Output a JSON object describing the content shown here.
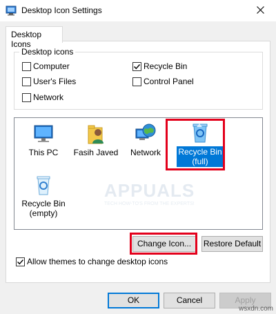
{
  "window": {
    "title": "Desktop Icon Settings"
  },
  "tabs": [
    {
      "label": "Desktop Icons"
    }
  ],
  "group": {
    "legend": "Desktop icons",
    "checkboxes": [
      {
        "label": "Computer",
        "checked": false
      },
      {
        "label": "Recycle Bin",
        "checked": true
      },
      {
        "label": "User's Files",
        "checked": false
      },
      {
        "label": "Control Panel",
        "checked": false
      },
      {
        "label": "Network",
        "checked": false
      }
    ]
  },
  "icons": [
    {
      "label": "This PC",
      "icon": "this-pc-icon",
      "selected": false
    },
    {
      "label": "Fasih Javed",
      "icon": "user-folder-icon",
      "selected": false
    },
    {
      "label": "Network",
      "icon": "network-globe-icon",
      "selected": false
    },
    {
      "label_line1": "Recycle Bin",
      "label_line2": "(full)",
      "icon": "recycle-bin-full-icon",
      "selected": true
    },
    {
      "label_line1": "Recycle Bin",
      "label_line2": "(empty)",
      "icon": "recycle-bin-empty-icon",
      "selected": false
    }
  ],
  "buttons": {
    "change_icon": "Change Icon...",
    "restore_default": "Restore Default",
    "ok": "OK",
    "cancel": "Cancel",
    "apply": "Apply"
  },
  "allow_themes": {
    "label": "Allow themes to change desktop icons",
    "checked": true
  },
  "watermark": {
    "text": "APPUALS",
    "tagline": "TECH HOW-TO'S FROM THE EXPERTS!"
  },
  "site_mark": "wsxdn.com",
  "colors": {
    "highlight_red": "#e3001b",
    "selection_blue": "#0078d7"
  }
}
